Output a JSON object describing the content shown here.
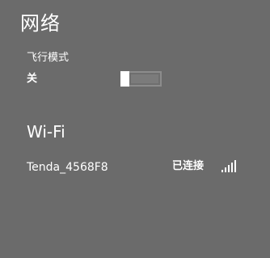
{
  "page": {
    "title": "网络"
  },
  "airplane_mode": {
    "label": "飞行模式",
    "state": "关"
  },
  "wifi_section": {
    "title": "Wi-Fi"
  },
  "networks": [
    {
      "ssid": "Tenda_4568F8",
      "status": "已连接",
      "signal_icon": "wifi-signal-icon"
    }
  ],
  "colors": {
    "background": "#6b6b6b",
    "text": "#ffffff",
    "toggle_thumb": "#ffffff",
    "toggle_track": "#7b7b7b"
  }
}
